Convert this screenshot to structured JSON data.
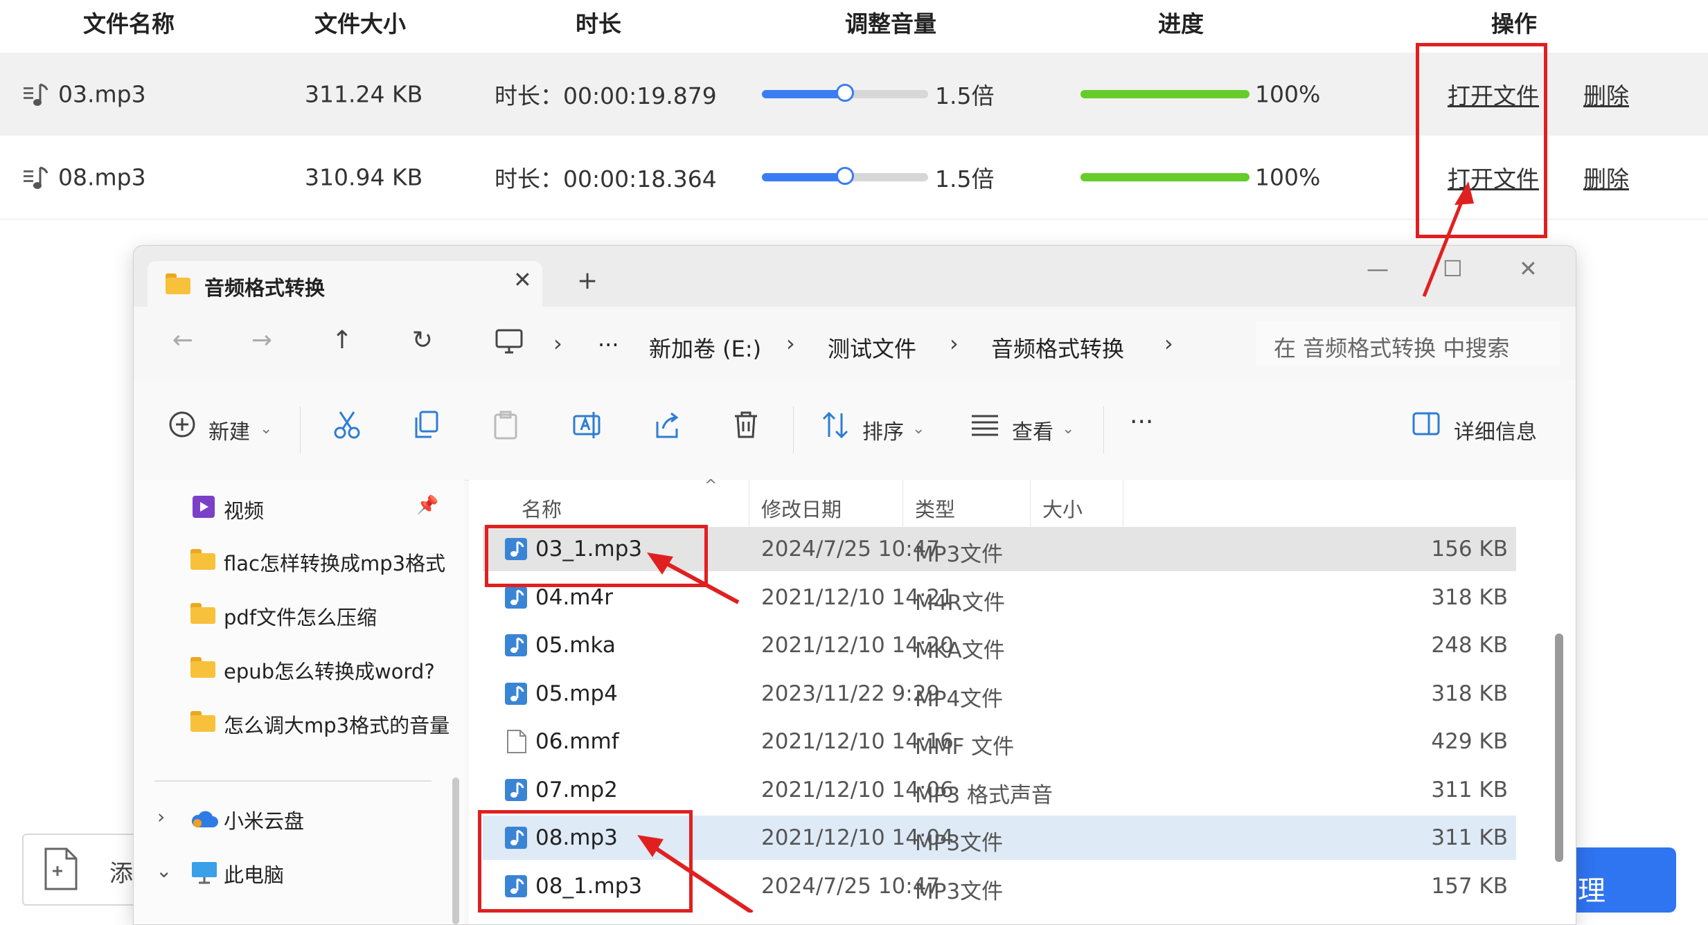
{
  "table": {
    "headers": {
      "name": "文件名称",
      "size": "文件大小",
      "duration": "时长",
      "volume": "调整音量",
      "progress": "进度",
      "actions": "操作"
    },
    "rows": [
      {
        "name": "03.mp3",
        "size": "311.24 KB",
        "duration": "时长：00:00:19.879",
        "volume_label": "1.5倍",
        "volume_level": 0.5,
        "progress_label": "100%",
        "progress": 1.0,
        "open": "打开文件",
        "delete": "删除"
      },
      {
        "name": "08.mp3",
        "size": "310.94 KB",
        "duration": "时长：00:00:18.364",
        "volume_label": "1.5倍",
        "volume_level": 0.5,
        "progress_label": "100%",
        "progress": 1.0,
        "open": "打开文件",
        "delete": "删除"
      }
    ],
    "add_button_partial": "添",
    "right_button_partial": "理"
  },
  "explorer": {
    "tab_title": "音频格式转换",
    "tab_close": "✕",
    "new_tab": "+",
    "window_controls": [
      "—",
      "☐",
      "✕"
    ],
    "nav": {
      "back": "←",
      "forward": "→",
      "up": "↑",
      "refresh": "↻",
      "more": "···",
      "breadcrumbs": [
        "新加卷 (E:)",
        "测试文件",
        "音频格式转换"
      ],
      "search_placeholder": "在 音频格式转换 中搜索"
    },
    "toolbar": {
      "new": "新建",
      "sort": "排序",
      "view": "查看",
      "more": "···",
      "details": "详细信息"
    },
    "sidebar": {
      "items": [
        {
          "label": "视频",
          "icon": "video-icon"
        },
        {
          "label": "flac怎样转换成mp3格式",
          "icon": "folder-icon"
        },
        {
          "label": "pdf文件怎么压缩",
          "icon": "folder-icon"
        },
        {
          "label": "epub怎么转换成word?",
          "icon": "folder-icon"
        },
        {
          "label": "怎么调大mp3格式的音量",
          "icon": "folder-icon"
        }
      ],
      "cloud": "小米云盘",
      "thispc": "此电脑"
    },
    "columns": {
      "name": "名称",
      "date": "修改日期",
      "type": "类型",
      "size": "大小"
    },
    "files": [
      {
        "name": "03_1.mp3",
        "date": "2024/7/25 10:47",
        "type": "MP3文件",
        "size": "156 KB"
      },
      {
        "name": "04.m4r",
        "date": "2021/12/10 14:21",
        "type": "M4R文件",
        "size": "318 KB"
      },
      {
        "name": "05.mka",
        "date": "2021/12/10 14:20",
        "type": "MKA文件",
        "size": "248 KB"
      },
      {
        "name": "05.mp4",
        "date": "2023/11/22 9:29",
        "type": "MP4文件",
        "size": "318 KB"
      },
      {
        "name": "06.mmf",
        "date": "2021/12/10 14:16",
        "type": "MMF 文件",
        "size": "429 KB"
      },
      {
        "name": "07.mp2",
        "date": "2021/12/10 14:06",
        "type": "MP3 格式声音",
        "size": "311 KB"
      },
      {
        "name": "08.mp3",
        "date": "2021/12/10 14:04",
        "type": "MP3文件",
        "size": "311 KB"
      },
      {
        "name": "08_1.mp3",
        "date": "2024/7/25 10:47",
        "type": "MP3文件",
        "size": "157 KB"
      }
    ]
  },
  "colors": {
    "annotation_red": "#e02020",
    "volume_blue": "#3b7cf4",
    "progress_green": "#66cc2a",
    "selected_row": "#e4e4e4",
    "highlight_row": "#dfeaf7"
  }
}
